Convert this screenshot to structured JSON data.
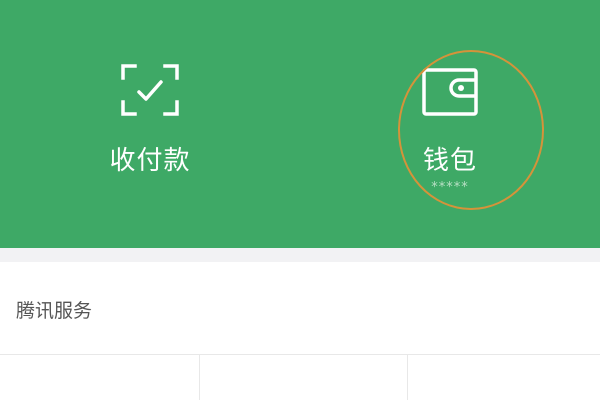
{
  "header": {
    "background_color": "#3ea966",
    "items": [
      {
        "label": "收付款",
        "icon": "scan-pay-icon"
      },
      {
        "label": "钱包",
        "icon": "wallet-icon",
        "sublabel": "*****",
        "highlight_color": "#d5933a"
      }
    ]
  },
  "services": {
    "title": "腾讯服务"
  }
}
